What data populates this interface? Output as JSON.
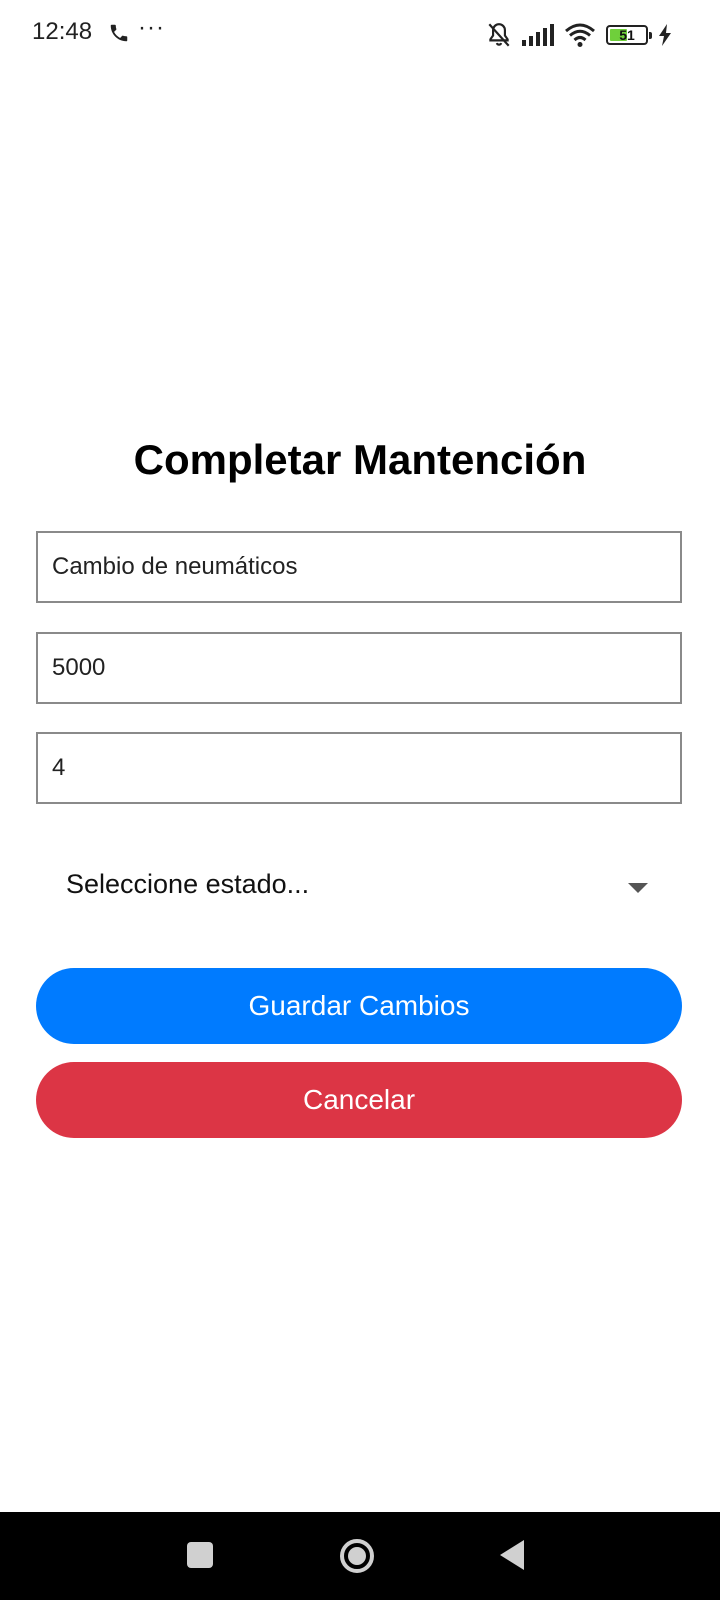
{
  "status_bar": {
    "time": "12:48",
    "more": "···",
    "battery_level": "51",
    "battery_fraction": 0.51,
    "icons": [
      "call-icon",
      "bell-off-icon",
      "signal-icon",
      "wifi-icon",
      "battery-icon",
      "charging-icon"
    ]
  },
  "form": {
    "title": "Completar Mantención",
    "description_value": "Cambio de neumáticos",
    "kilometers_value": "5000",
    "quantity_value": "4",
    "status_select": {
      "selected": "Seleccione estado..."
    }
  },
  "buttons": {
    "save_label": "Guardar Cambios",
    "cancel_label": "Cancelar"
  },
  "colors": {
    "save": "#007bff",
    "cancel": "#dc3545",
    "battery": "#6fcf3b"
  },
  "nav_bar": {
    "icons": [
      "recent-apps-icon",
      "home-icon",
      "back-icon"
    ]
  }
}
